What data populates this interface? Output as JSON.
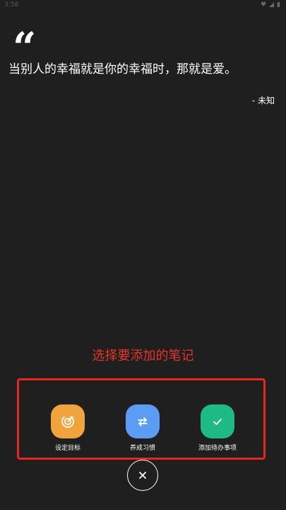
{
  "status_bar": {
    "time": "3:58",
    "icons": [
      "heart-icon",
      "signal-icon",
      "battery-icon"
    ]
  },
  "quote": {
    "mark": "“",
    "text": "当别人的幸福就是你的幸福时，那就是爱。",
    "author": "- 未知"
  },
  "prompt": {
    "text": "选择要添加的笔记"
  },
  "actions": [
    {
      "label": "设定目标",
      "icon": "target-icon",
      "color": "#f1a43c"
    },
    {
      "label": "养成习惯",
      "icon": "repeat-icon",
      "color": "#5b9df5"
    },
    {
      "label": "添加待办事项",
      "icon": "check-icon",
      "color": "#1dba85"
    }
  ],
  "close": {
    "icon": "close-icon"
  },
  "colors": {
    "background": "#1f1f1f",
    "highlight": "#e8261a",
    "prompt": "#e53525"
  }
}
